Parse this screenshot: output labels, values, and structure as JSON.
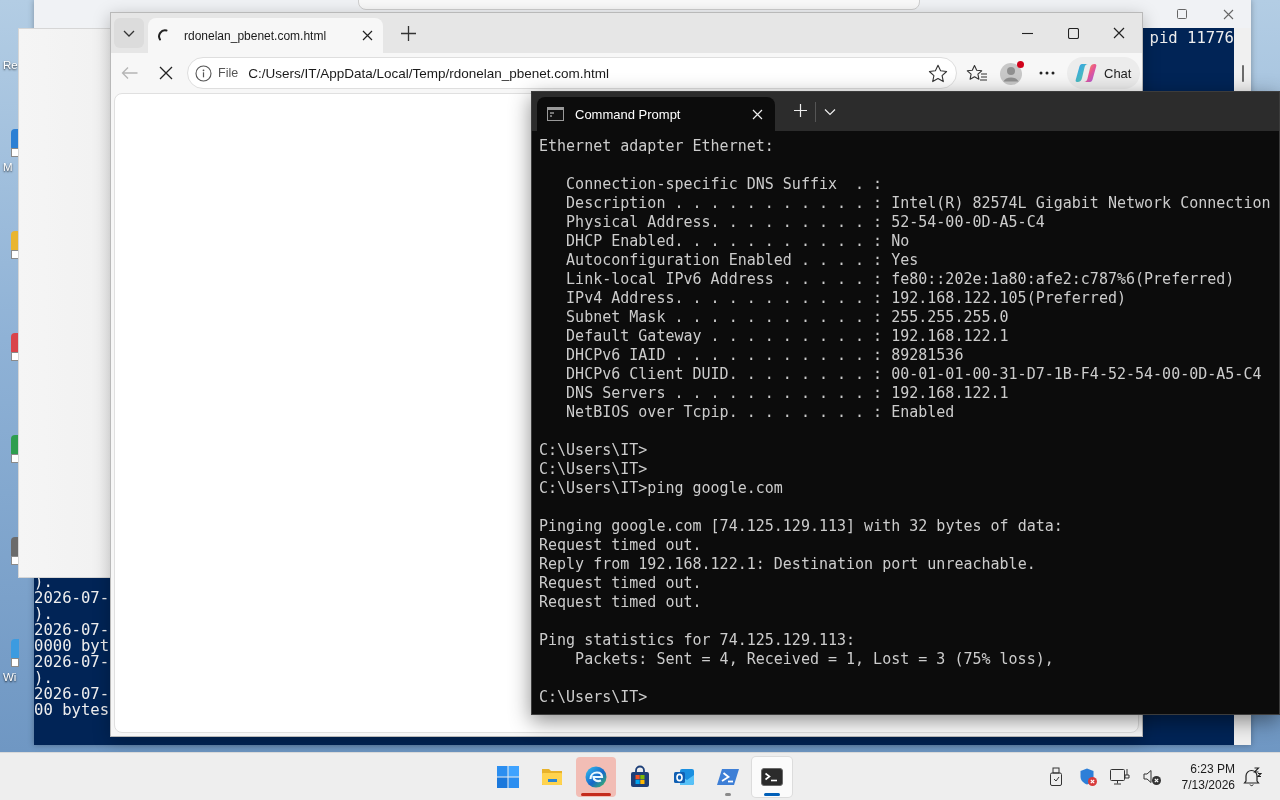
{
  "desktop_icons": [
    {
      "label": "Re"
    },
    {
      "color": "#2b7fd4",
      "label": "M"
    },
    {
      "color": "#e9b52f"
    },
    {
      "color": "#d9444a"
    },
    {
      "color": "#2f9e4f"
    },
    {
      "color": "#6b6b6b"
    },
    {
      "color": "#3c9be0",
      "label": "Wi"
    }
  ],
  "console_window": {
    "top_fragment": "pid 11776",
    "bottom_lines": [
      ").",
      "2026-07-",
      ").",
      "2026-07-",
      "0000 byt",
      "2026-07-",
      ").",
      "2026-07-",
      "00 bytes"
    ]
  },
  "browser": {
    "tabs": [
      {
        "title": "rdonelan_pbenet.com.html",
        "loading": true,
        "selected": true
      }
    ],
    "back_disabled": true,
    "address": {
      "scheme": "File",
      "url": "C:/Users/IT/AppData/Local/Temp/rdonelan_pbenet.com.html"
    },
    "profile_alert": true,
    "copilot_label": "Chat"
  },
  "terminal": {
    "tabs": [
      {
        "title": "Command Prompt",
        "selected": true
      }
    ],
    "blocks": [
      {
        "kind": "output",
        "lines": [
          "Ethernet adapter Ethernet:"
        ]
      },
      {
        "kind": "properties",
        "lines": [
          "Connection-specific DNS Suffix  . :",
          "Description . . . . . . . . . . . : Intel(R) 82574L Gigabit Network Connection",
          "Physical Address. . . . . . . . . : 52-54-00-0D-A5-C4",
          "DHCP Enabled. . . . . . . . . . . : No",
          "Autoconfiguration Enabled . . . . : Yes",
          "Link-local IPv6 Address . . . . . : fe80::202e:1a80:afe2:c787%6(Preferred)",
          "IPv4 Address. . . . . . . . . . . : 192.168.122.105(Preferred)",
          "Subnet Mask . . . . . . . . . . . : 255.255.255.0",
          "Default Gateway . . . . . . . . . : 192.168.122.1",
          "DHCPv6 IAID . . . . . . . . . . . : 89281536",
          "DHCPv6 Client DUID. . . . . . . . : 00-01-01-00-31-D7-1B-F4-52-54-00-0D-A5-C4",
          "DNS Servers . . . . . . . . . . . : 192.168.122.1",
          "NetBIOS over Tcpip. . . . . . . . : Enabled"
        ]
      },
      {
        "kind": "output",
        "lines": [
          "C:\\Users\\IT>",
          "C:\\Users\\IT>",
          "C:\\Users\\IT>ping google.com"
        ]
      },
      {
        "kind": "output",
        "lines": [
          "Pinging google.com [74.125.129.113] with 32 bytes of data:",
          "Request timed out.",
          "Reply from 192.168.122.1: Destination port unreachable.",
          "Request timed out.",
          "Request timed out."
        ]
      },
      {
        "kind": "summary",
        "lines": [
          "Ping statistics for 74.125.129.113:",
          "Packets: Sent = 4, Received = 1, Lost = 3 (75% loss),"
        ]
      },
      {
        "kind": "output",
        "lines": [
          "C:\\Users\\IT>"
        ]
      }
    ]
  },
  "taskbar": {
    "apps": [
      {
        "kind": "start",
        "running": false,
        "selected": false,
        "attention": false
      },
      {
        "kind": "explorer",
        "running": false,
        "selected": false,
        "attention": false
      },
      {
        "kind": "browser",
        "running": true,
        "selected": false,
        "attention": true
      },
      {
        "kind": "store",
        "running": false,
        "selected": false,
        "attention": false
      },
      {
        "kind": "mail",
        "running": false,
        "selected": false,
        "attention": false
      },
      {
        "kind": "shell",
        "running": true,
        "selected": false,
        "attention": false
      },
      {
        "kind": "terminal",
        "running": true,
        "selected": true,
        "attention": false
      }
    ],
    "tray": [
      {
        "kind": "usb"
      },
      {
        "kind": "security",
        "alert": true
      },
      {
        "kind": "network"
      },
      {
        "kind": "volume",
        "muted": true
      }
    ],
    "clock": {
      "time": "6:23 PM",
      "date": "7/13/2026"
    },
    "do_not_disturb": true
  }
}
